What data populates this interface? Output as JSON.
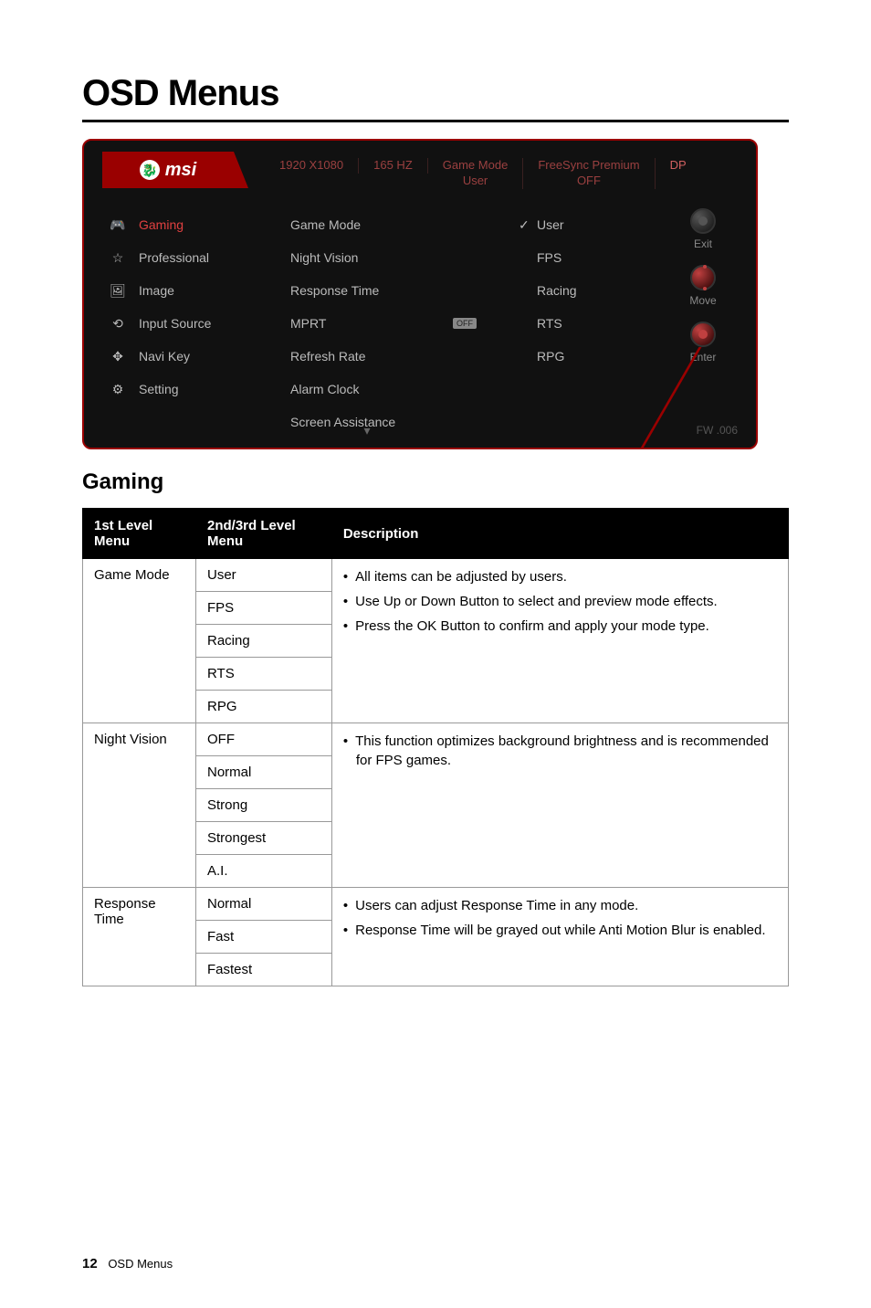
{
  "page": {
    "title": "OSD Menus",
    "section": "Gaming",
    "footer_page": "12",
    "footer_label": "OSD Menus"
  },
  "osd": {
    "logo": "msi",
    "status": {
      "resolution": "1920 X1080",
      "refresh": "165 HZ",
      "mode_label": "Game Mode",
      "mode_value": "User",
      "freesync_label": "FreeSync Premium",
      "freesync_value": "OFF",
      "input": "DP"
    },
    "left_menu": [
      {
        "icon": "🎮",
        "label": "Gaming",
        "active": true,
        "name": "sidebar-item-gaming"
      },
      {
        "icon": "☆",
        "label": "Professional",
        "active": false,
        "name": "sidebar-item-professional"
      },
      {
        "icon": "🖼",
        "label": "Image",
        "active": false,
        "name": "sidebar-item-image"
      },
      {
        "icon": "⟲",
        "label": "Input Source",
        "active": false,
        "name": "sidebar-item-input-source"
      },
      {
        "icon": "✥",
        "label": "Navi Key",
        "active": false,
        "name": "sidebar-item-navi-key"
      },
      {
        "icon": "⚙",
        "label": "Setting",
        "active": false,
        "name": "sidebar-item-setting"
      }
    ],
    "mid_menu": [
      {
        "label": "Game Mode",
        "badge": null
      },
      {
        "label": "Night Vision",
        "badge": null
      },
      {
        "label": "Response Time",
        "badge": null
      },
      {
        "label": "MPRT",
        "badge": "OFF"
      },
      {
        "label": "Refresh Rate",
        "badge": null
      },
      {
        "label": "Alarm Clock",
        "badge": null
      },
      {
        "label": "Screen Assistance",
        "badge": null
      }
    ],
    "right_menu": [
      {
        "label": "User",
        "checked": true
      },
      {
        "label": "FPS",
        "checked": false
      },
      {
        "label": "Racing",
        "checked": false
      },
      {
        "label": "RTS",
        "checked": false
      },
      {
        "label": "RPG",
        "checked": false
      }
    ],
    "hints": {
      "exit": "Exit",
      "move": "Move",
      "enter": "Enter",
      "fw": "FW .006"
    }
  },
  "table": {
    "headers": [
      "1st Level Menu",
      "2nd/3rd Level Menu",
      "Description"
    ],
    "groups": [
      {
        "first": "Game Mode",
        "seconds": [
          "User",
          "FPS",
          "Racing",
          "RTS",
          "RPG"
        ],
        "desc": [
          "All items can be adjusted by users.",
          "Use Up or Down Button to select and preview mode effects.",
          "Press the OK Button to confirm and apply your mode type."
        ]
      },
      {
        "first": "Night Vision",
        "seconds": [
          "OFF",
          "Normal",
          "Strong",
          "Strongest",
          "A.I."
        ],
        "desc": [
          "This function optimizes background brightness and is recommended for FPS games."
        ]
      },
      {
        "first": "Response Time",
        "seconds": [
          "Normal",
          "Fast",
          "Fastest"
        ],
        "desc": [
          "Users can adjust Response Time in any mode.",
          "Response Time will be grayed out while Anti Motion Blur is enabled."
        ]
      }
    ]
  }
}
